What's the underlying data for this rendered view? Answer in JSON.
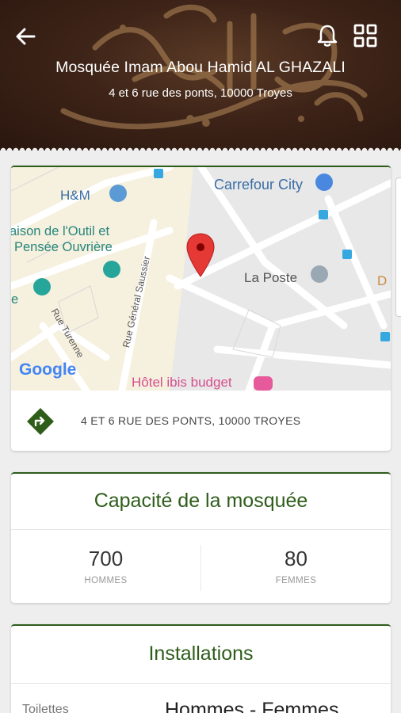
{
  "header": {
    "title": "Mosquée Imam Abou Hamid AL GHAZALI",
    "address": "4 et 6 rue des ponts, 10000 Troyes",
    "back_icon": "arrow-left-icon",
    "bell_icon": "bell-icon",
    "grid_icon": "grid-icon"
  },
  "map": {
    "labels": {
      "hm": "H&M",
      "carrefour": "Carrefour City",
      "maison_1": "aison de l'Outil et",
      "maison_2": "Pensée Ouvrière",
      "rue_turenne": "Rue Turenne",
      "rue_saussier": "Rue Général Saussier",
      "la_poste": "La Poste",
      "ibis": "Hôtel ibis budget",
      "google": "Google",
      "edge_d": "D",
      "edge_e": "e"
    },
    "pin_color": "#d93025"
  },
  "address_bar": {
    "text": "4 ET 6 RUE DES PONTS, 10000 TROYES",
    "icon": "directions-icon"
  },
  "capacity": {
    "title": "Capacité de la mosquée",
    "men_value": "700",
    "men_label": "HOMMES",
    "women_value": "80",
    "women_label": "FEMMES"
  },
  "installations": {
    "title": "Installations",
    "row_label": "Toilettes",
    "row_value": "Hommes - Femmes"
  },
  "colors": {
    "accent_green": "#2e5d1a",
    "header_brown": "#3e2418"
  }
}
